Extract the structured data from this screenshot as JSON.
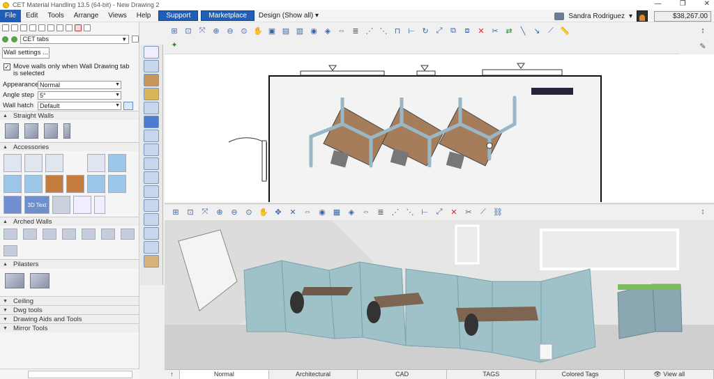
{
  "window": {
    "title": "CET Material Handling 13.5 (64-bit) - New Drawing 2"
  },
  "menu": [
    "File",
    "Edit",
    "Tools",
    "Arrange",
    "Views",
    "Help"
  ],
  "buttons": {
    "support": "Support",
    "marketplace": "Marketplace"
  },
  "design": "Design (Show all)",
  "user": {
    "name": "Sandra Rodriguez",
    "price": "$38,267.00"
  },
  "tabs_combo": "CET tabs",
  "wall_settings": "Wall settings ...",
  "move_walls": "Move walls only when Wall Drawing tab is selected",
  "props": {
    "appearance": {
      "label": "Appearance",
      "value": "Normal"
    },
    "angle": {
      "label": "Angle step",
      "value": "5°"
    },
    "hatch": {
      "label": "Wall hatch",
      "value": "Default"
    }
  },
  "sections": {
    "straight": "Straight Walls",
    "accessories": "Accessories",
    "arched": "Arched Walls",
    "pilasters": "Pilasters",
    "ceiling": "Ceiling",
    "dwg": "Dwg tools",
    "aids": "Drawing Aids and Tools",
    "mirror": "Mirror Tools"
  },
  "accessory_text": "3D Text",
  "view_tabs": [
    "Normal",
    "Architectural",
    "CAD",
    "TAGS",
    "Colored Tags",
    "View all"
  ],
  "colors": {
    "accent": "#1f5fb8",
    "panel_blue": "#9fc1c8",
    "desk_wood": "#a57d5b"
  }
}
